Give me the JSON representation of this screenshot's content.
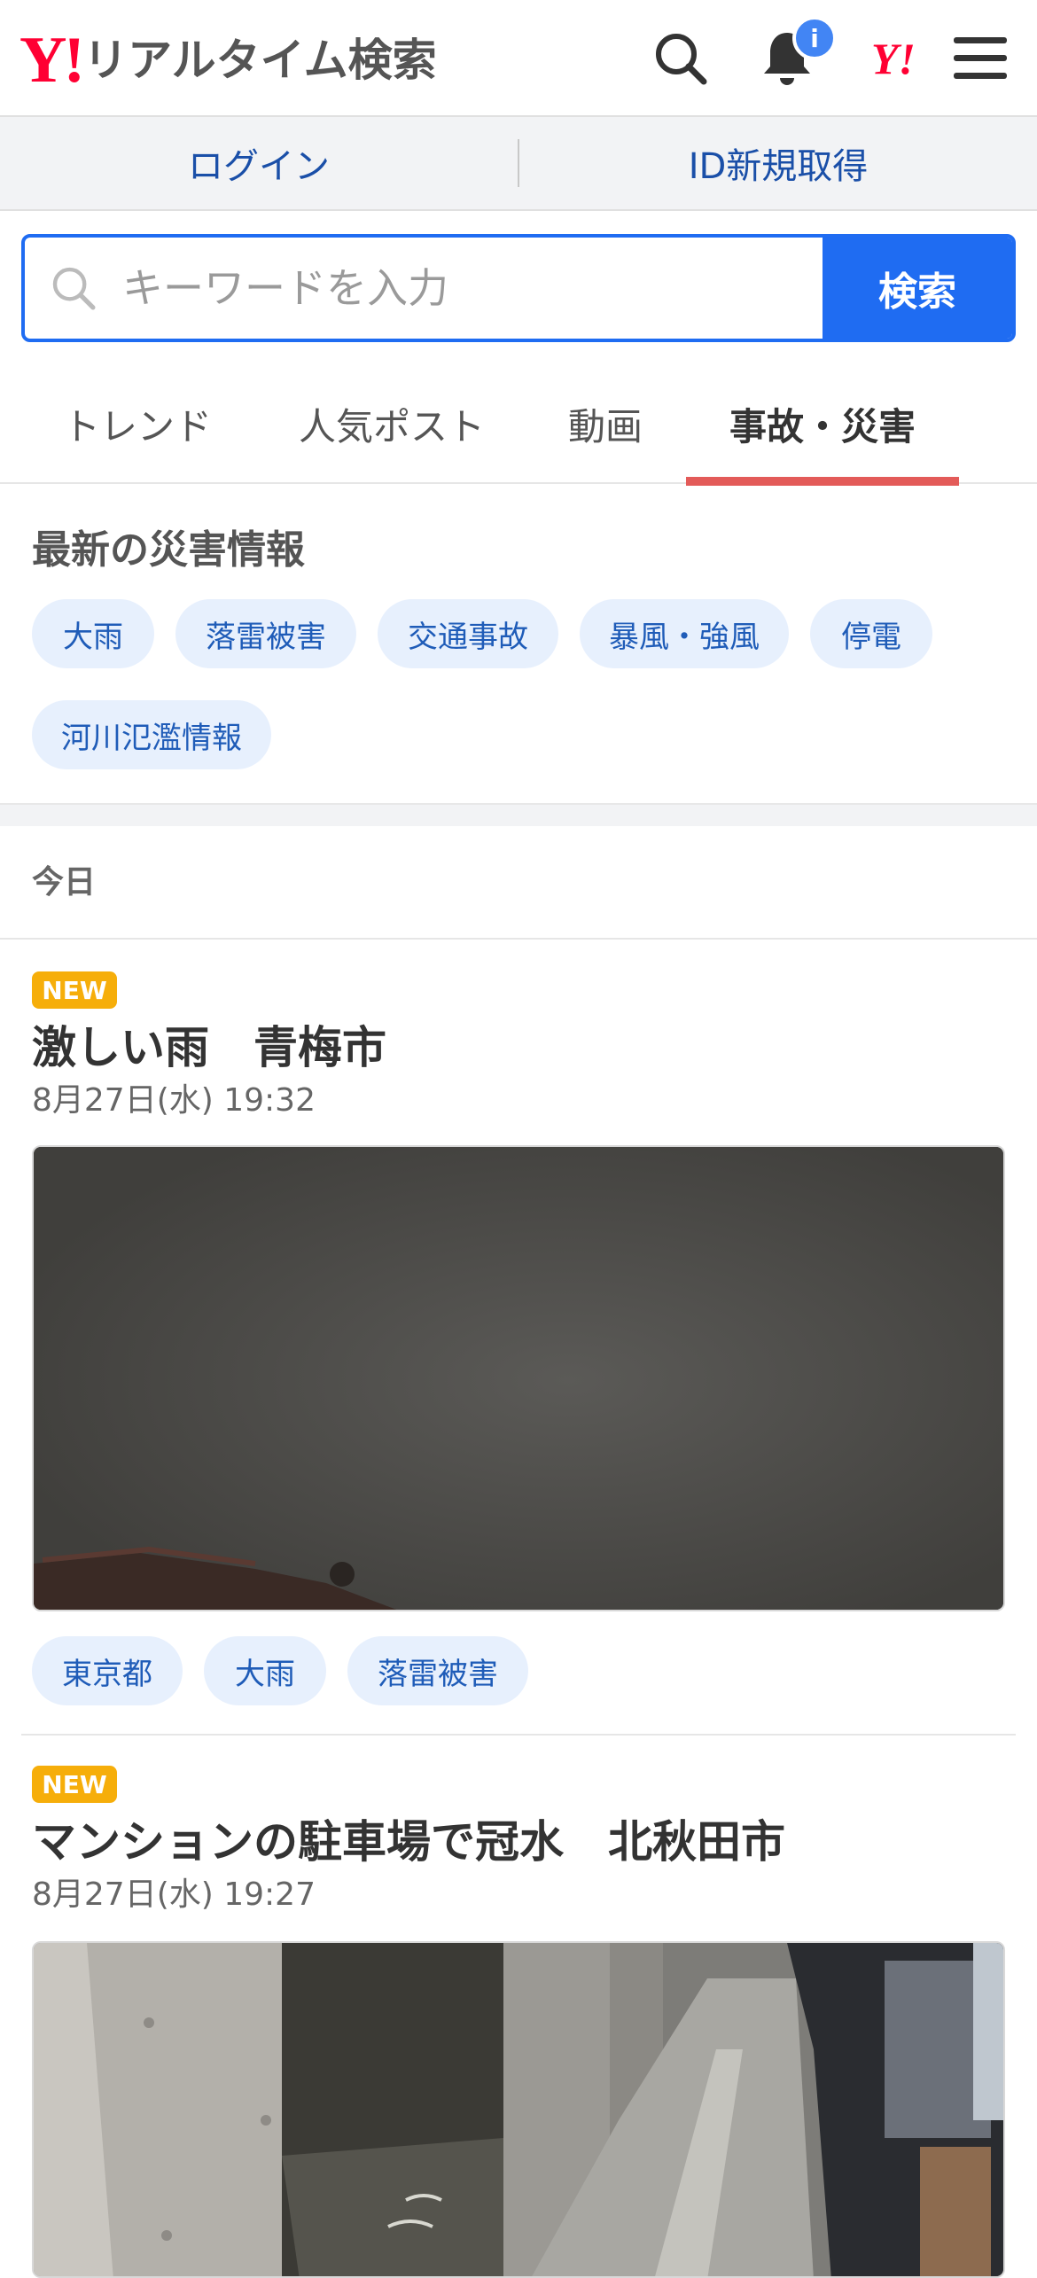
{
  "header": {
    "logo_mark": "Y!",
    "logo_text": "リアルタイム検索",
    "notification_badge": "i",
    "yahoo_mini": "Y!"
  },
  "account": {
    "login_label": "ログイン",
    "register_label": "ID新規取得"
  },
  "search": {
    "placeholder": "キーワードを入力",
    "button_label": "検索"
  },
  "tabs": [
    {
      "label": "トレンド",
      "active": false
    },
    {
      "label": "人気ポスト",
      "active": false
    },
    {
      "label": "動画",
      "active": false
    },
    {
      "label": "事故・災害",
      "active": true
    }
  ],
  "disaster": {
    "title": "最新の災害情報",
    "chips": [
      "大雨",
      "落雷被害",
      "交通事故",
      "暴風・強風",
      "停電",
      "河川氾濫情報"
    ]
  },
  "feed": {
    "day_label": "今日",
    "posts": [
      {
        "badge": "NEW",
        "title": "激しい雨　青梅市",
        "date": "8月27日(水) 19:32",
        "tags": [
          "東京都",
          "大雨",
          "落雷被害"
        ]
      },
      {
        "badge": "NEW",
        "title": "マンションの駐車場で冠水　北秋田市",
        "date": "8月27日(水) 19:27",
        "tags": []
      }
    ]
  },
  "colors": {
    "brand_red": "#ff0033",
    "search_blue": "#1f6cf2",
    "link_blue": "#1a4fa8",
    "chip_bg": "#e7f0fd",
    "tab_underline": "#e35b59",
    "new_badge": "#f6ae0a"
  }
}
